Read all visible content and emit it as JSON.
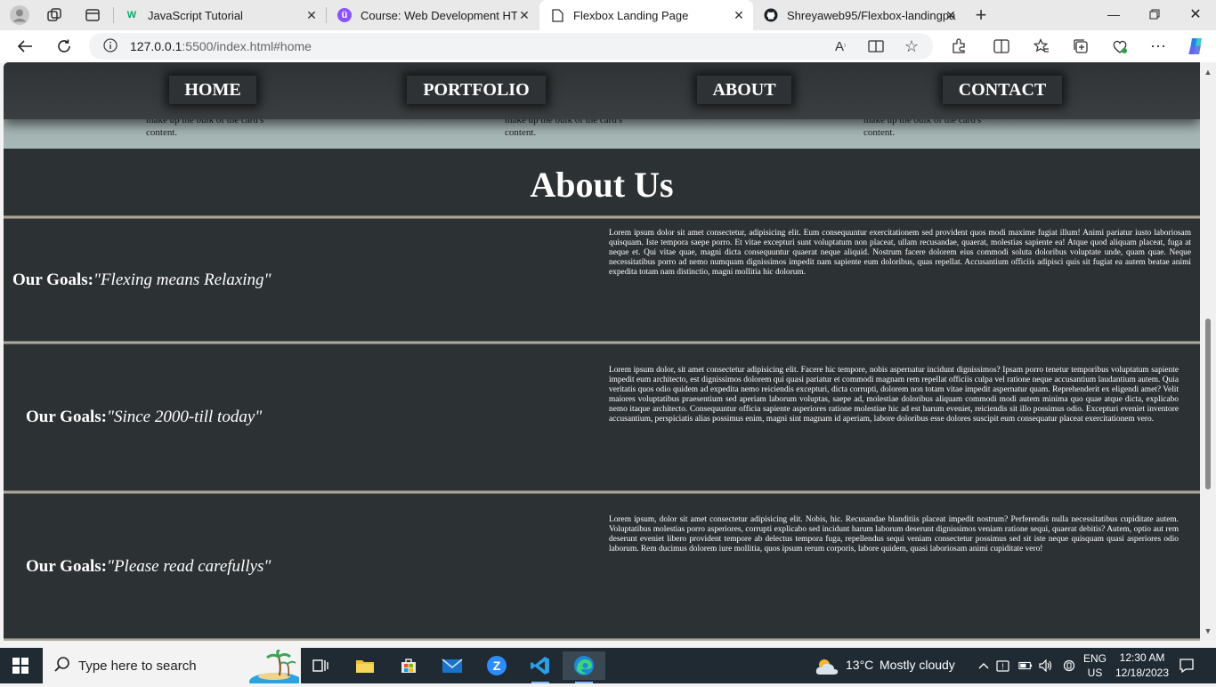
{
  "browser": {
    "tabs": [
      {
        "title": "JavaScript Tutorial",
        "icon": "w3schools-icon",
        "active": false
      },
      {
        "title": "Course: Web Development HTML",
        "icon": "course-icon",
        "active": false
      },
      {
        "title": "Flexbox Landing Page",
        "icon": "page-icon",
        "active": true
      },
      {
        "title": "Shreyaweb95/Flexbox-landingpa",
        "icon": "github-icon",
        "active": false
      }
    ],
    "url_host": "127.0.0.1",
    "url_path": ":5500/index.html#home"
  },
  "page": {
    "nav": [
      "HOME",
      "PORTFOLIO",
      "ABOUT",
      "CONTACT"
    ],
    "card_text_line1": "make up the bulk of the card's",
    "card_text_line2": "content.",
    "about_title": "About Us",
    "goals": [
      {
        "label": "Our Goals:",
        "quote": "\"Flexing means Relaxing\"",
        "text": "Lorem ipsum dolor sit amet consectetur, adipisicing elit. Eum consequuntur exercitationem sed provident quos modi maxime fugiat illum! Animi pariatur iusto laboriosam quisquam. Iste tempora saepe porro. Et vitae excepturi sunt voluptatum non placeat, ullam recusandae, quaerat, molestias sapiente ea! Atque quod aliquam placeat, fuga at neque et. Qui vitae quae, magni dicta consequuntur quaerat neque aliquid. Nostrum facere dolorem eius commodi soluta doloribus voluptate unde, quam quae. Neque necessitatibus porro ad nemo numquam dignissimos impedit nam sapiente eum doloribus, quas repellat. Accusantium officiis adipisci quis sit fugiat ea autem beatae animi expedita totam nam distinctio, magni mollitia hic dolorum."
      },
      {
        "label": "Our Goals:",
        "quote": "\"Since 2000-till today\"",
        "text": "Lorem ipsum dolor, sit amet consectetur adipisicing elit. Facere hic tempore, nobis aspernatur incidunt dignissimos? Ipsam porro tenetur temporibus voluptatum sapiente impedit eum architecto, est dignissimos dolorem qui quasi pariatur et commodi magnam rem repellat officiis culpa vel ratione neque accusantium laudantium autem. Quia veritatis quos odio quidem ad expedita nemo reiciendis excepturi, dicta corrupti, dolorem non totam vitae impedit aspernatur quam. Reprehenderit ex eligendi amet? Velit maiores voluptatibus praesentium sed aperiam laborum voluptas, saepe ad, molestiae doloribus aliquam commodi modi autem minima quo quae atque dicta, explicabo nemo itaque architecto. Consequuntur officia sapiente asperiores ratione molestiae hic ad est harum eveniet, reiciendis sit illo possimus odio. Excepturi eveniet inventore accusantium, perspiciatis alias possimus enim, magni sint magnam id aperiam, labore doloribus esse dolores suscipit eum consequatur placeat exercitationem vero."
      },
      {
        "label": "Our Goals:",
        "quote": "\"Please read carefullys\"",
        "text": "Lorem ipsum, dolor sit amet consectetur adipisicing elit. Nobis, hic. Recusandae blanditiis placeat impedit nostrum? Perferendis nulla necessitatibus cupiditate autem. Voluptatibus molestias porro asperiores, corrupti explicabo sed incidunt harum laborum deserunt dignissimos veniam ratione sequi, quaerat debitis? Autem, optio aut rem deserunt eveniet libero provident tempore ab delectus tempora fuga, repellendus sequi veniam consectetur possimus sed sit iste neque quisquam quasi asperiores odio laborum. Rem ducimus dolorem iure mollitia, quos ipsum rerum corporis, labore quidem, quasi laboriosam animi cupiditate vero!"
      }
    ]
  },
  "taskbar": {
    "search_placeholder": "Type here to search",
    "weather_temp": "13°C",
    "weather_desc": "Mostly cloudy",
    "lang1": "ENG",
    "lang2": "US",
    "time": "12:30 AM",
    "date": "12/18/2023"
  }
}
